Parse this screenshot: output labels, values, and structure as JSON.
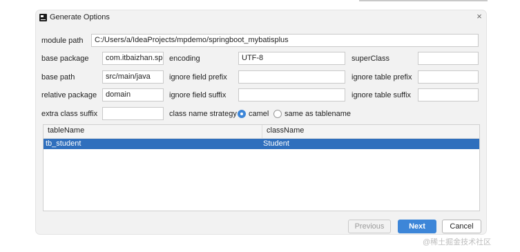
{
  "dialog": {
    "title": "Generate Options",
    "close_symbol": "×",
    "app_icon": "intellij-icon"
  },
  "fields": {
    "module_path": {
      "label": "module path",
      "value": "C:/Users/a/IdeaProjects/mpdemo/springboot_mybatisplus"
    },
    "base_package": {
      "label": "base package",
      "value": "com.itbaizhan.sp"
    },
    "encoding": {
      "label": "encoding",
      "value": "UTF-8"
    },
    "super_class": {
      "label": "superClass",
      "value": ""
    },
    "base_path": {
      "label": "base path",
      "value": "src/main/java"
    },
    "ignore_field_prefix": {
      "label": "ignore field prefix",
      "value": ""
    },
    "ignore_table_prefix": {
      "label": "ignore table prefix",
      "value": ""
    },
    "relative_package": {
      "label": "relative package",
      "value": "domain"
    },
    "ignore_field_suffix": {
      "label": "ignore field suffix",
      "value": ""
    },
    "ignore_table_suffix": {
      "label": "ignore table suffix",
      "value": ""
    },
    "extra_class_suffix": {
      "label": "extra class suffix",
      "value": ""
    }
  },
  "strategy": {
    "label": "class name strategy",
    "options": [
      {
        "label": "camel",
        "selected": true
      },
      {
        "label": "same as tablename",
        "selected": false
      }
    ]
  },
  "table": {
    "columns": [
      "tableName",
      "className"
    ],
    "rows": [
      {
        "tableName": "tb_student",
        "className": "Student",
        "selected": true
      }
    ]
  },
  "buttons": {
    "previous": "Previous",
    "next": "Next",
    "cancel": "Cancel"
  },
  "colors": {
    "accent": "#3d86d8",
    "selection": "#2f6fbd",
    "dialog_bg": "#f2f2f2"
  },
  "watermark": "@稀土掘金技术社区"
}
